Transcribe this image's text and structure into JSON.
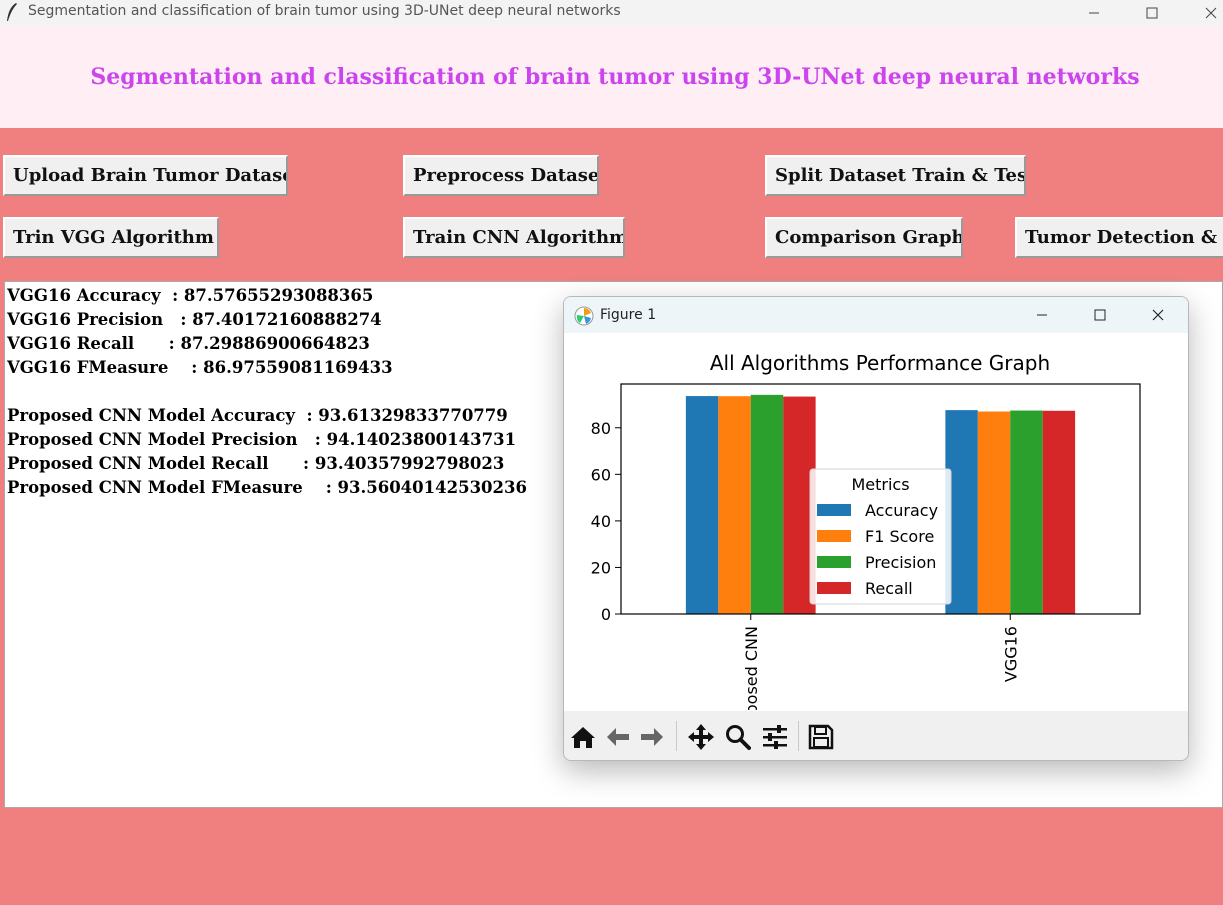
{
  "window": {
    "title": "Segmentation and classification of brain tumor using 3D-UNet deep neural networks"
  },
  "heading": "Segmentation and classification of brain tumor using 3D-UNet deep neural networks",
  "buttons": {
    "upload": "Upload Brain Tumor Dataset",
    "preprocess": "Preprocess Dataset",
    "split": "Split Dataset Train & Test",
    "train_vgg": "Trin VGG Algorithm",
    "train_cnn": "Train CNN Algorithm",
    "comparison": "Comparison Graph",
    "detection": "Tumor Detection & Segmentation"
  },
  "output": {
    "lines": [
      "VGG16 Accuracy  : 87.57655293088365",
      "VGG16 Precision   : 87.40172160888274",
      "VGG16 Recall      : 87.29886900664823",
      "VGG16 FMeasure    : 86.97559081169433",
      "",
      "Proposed CNN Model Accuracy  : 93.61329833770779",
      "Proposed CNN Model Precision   : 94.14023800143731",
      "Proposed CNN Model Recall      : 93.40357992798023",
      "Proposed CNN Model FMeasure    : 93.56040142530236"
    ]
  },
  "figure": {
    "window_title": "Figure 1",
    "toolbar_icons": [
      "home-icon",
      "back-arrow-icon",
      "forward-arrow-icon",
      "pan-icon",
      "zoom-icon",
      "configure-subplots-icon",
      "save-icon"
    ]
  },
  "colors": {
    "background": "#f08080",
    "heading_band": "#ffeef3",
    "heading_text": "#cc44ee",
    "accuracy": "#1f77b4",
    "f1": "#ff7f0e",
    "precision": "#2ca02c",
    "recall": "#d62728"
  },
  "chart_data": {
    "type": "bar",
    "title": "All Algorithms Performance Graph",
    "categories": [
      "Proposed CNN",
      "VGG16"
    ],
    "legend_title": "Metrics",
    "legend_position": "center",
    "series": [
      {
        "name": "Accuracy",
        "color": "#1f77b4",
        "values": [
          93.61,
          87.58
        ]
      },
      {
        "name": "F1 Score",
        "color": "#ff7f0e",
        "values": [
          93.56,
          86.98
        ]
      },
      {
        "name": "Precision",
        "color": "#2ca02c",
        "values": [
          94.14,
          87.4
        ]
      },
      {
        "name": "Recall",
        "color": "#d62728",
        "values": [
          93.4,
          87.3
        ]
      }
    ],
    "yticks": [
      0,
      20,
      40,
      60,
      80
    ],
    "ylim": [
      0,
      98.8
    ],
    "grid": false
  }
}
